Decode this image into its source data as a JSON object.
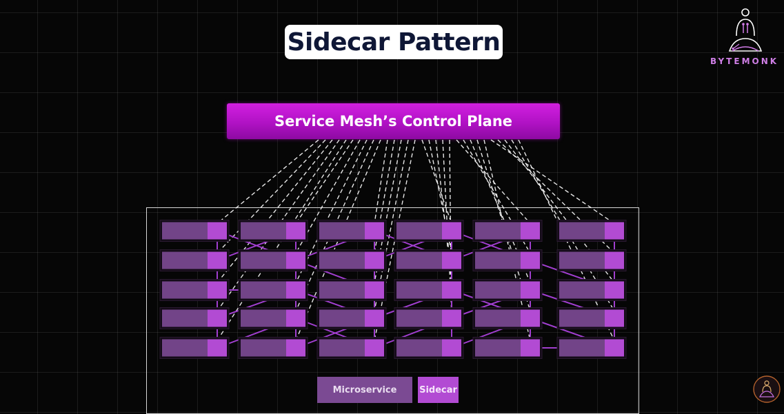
{
  "title": "Sidecar Pattern",
  "control_plane": {
    "label": "Service Mesh’s Control Plane"
  },
  "legend": {
    "microservice": "Microservice",
    "sidecar": "Sidecar"
  },
  "brand": {
    "name": "BYTEMONK"
  },
  "colors": {
    "microservice": "#7b4a93",
    "sidecar": "#b24bd3",
    "control_plane": "#b012c4",
    "mesh_link": "#a13ed0",
    "brand": "#cf7fe6"
  },
  "grid": {
    "columns": 6,
    "rows": 5
  },
  "mesh_links": [
    [
      [
        0,
        0
      ],
      [
        1,
        1
      ]
    ],
    [
      [
        0,
        1
      ],
      [
        1,
        0
      ]
    ],
    [
      [
        1,
        1
      ],
      [
        2,
        0
      ]
    ],
    [
      [
        1,
        1
      ],
      [
        2,
        2
      ]
    ],
    [
      [
        2,
        1
      ],
      [
        3,
        0
      ]
    ],
    [
      [
        2,
        0
      ],
      [
        3,
        1
      ]
    ],
    [
      [
        3,
        0
      ],
      [
        4,
        1
      ]
    ],
    [
      [
        3,
        1
      ],
      [
        4,
        0
      ]
    ],
    [
      [
        4,
        1
      ],
      [
        5,
        2
      ]
    ],
    [
      [
        0,
        3
      ],
      [
        1,
        2
      ]
    ],
    [
      [
        1,
        2
      ],
      [
        2,
        3
      ]
    ],
    [
      [
        1,
        4
      ],
      [
        2,
        3
      ]
    ],
    [
      [
        2,
        3
      ],
      [
        3,
        2
      ]
    ],
    [
      [
        2,
        4
      ],
      [
        3,
        3
      ]
    ],
    [
      [
        3,
        2
      ],
      [
        4,
        3
      ]
    ],
    [
      [
        3,
        3
      ],
      [
        4,
        2
      ]
    ],
    [
      [
        4,
        3
      ],
      [
        5,
        4
      ]
    ],
    [
      [
        4,
        2
      ],
      [
        5,
        3
      ]
    ],
    [
      [
        0,
        4
      ],
      [
        1,
        3
      ]
    ],
    [
      [
        1,
        3
      ],
      [
        2,
        4
      ]
    ],
    [
      [
        3,
        4
      ],
      [
        4,
        3
      ]
    ],
    [
      [
        0,
        2
      ],
      [
        1,
        2
      ]
    ],
    [
      [
        4,
        4
      ],
      [
        5,
        4
      ]
    ]
  ]
}
